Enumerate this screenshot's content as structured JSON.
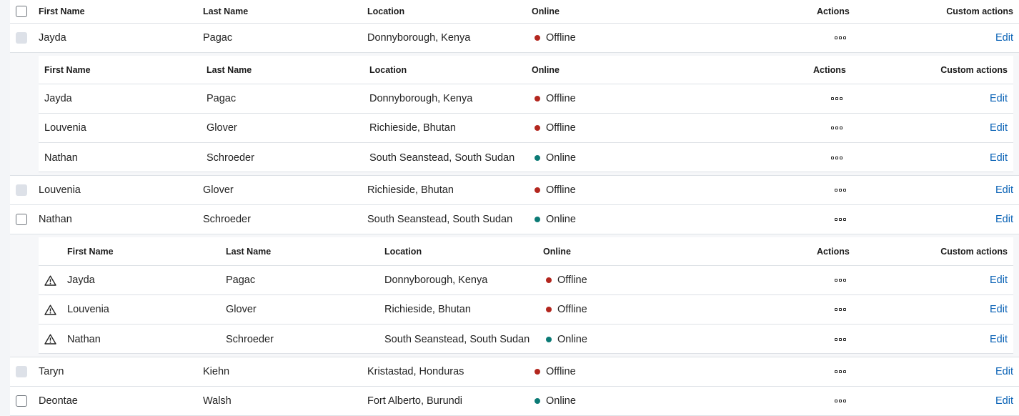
{
  "columns": {
    "first_name": "First Name",
    "last_name": "Last Name",
    "location": "Location",
    "online": "Online",
    "actions": "Actions",
    "custom_actions": "Custom actions"
  },
  "edit_label": "Edit",
  "status_colors": {
    "Offline": "#b3261e",
    "Online": "#0b7a75"
  },
  "rows": [
    {
      "first": "Jayda",
      "last": "Pagac",
      "location": "Donnyborough, Kenya",
      "status": "Offline",
      "checkbox": "disabled"
    },
    {
      "first": "Louvenia",
      "last": "Glover",
      "location": "Richieside, Bhutan",
      "status": "Offline",
      "checkbox": "disabled"
    },
    {
      "first": "Nathan",
      "last": "Schroeder",
      "location": "South Seanstead, South Sudan",
      "status": "Online",
      "checkbox": "enabled"
    },
    {
      "first": "Taryn",
      "last": "Kiehn",
      "location": "Kristastad, Honduras",
      "status": "Offline",
      "checkbox": "disabled"
    },
    {
      "first": "Deontae",
      "last": "Walsh",
      "location": "Fort Alberto, Burundi",
      "status": "Online",
      "checkbox": "enabled"
    }
  ],
  "nested_a": [
    {
      "first": "Jayda",
      "last": "Pagac",
      "location": "Donnyborough, Kenya",
      "status": "Offline"
    },
    {
      "first": "Louvenia",
      "last": "Glover",
      "location": "Richieside, Bhutan",
      "status": "Offline"
    },
    {
      "first": "Nathan",
      "last": "Schroeder",
      "location": "South Seanstead, South Sudan",
      "status": "Online"
    }
  ],
  "nested_b": [
    {
      "first": "Jayda",
      "last": "Pagac",
      "location": "Donnyborough, Kenya",
      "status": "Offline",
      "icon": "warning-icon"
    },
    {
      "first": "Louvenia",
      "last": "Glover",
      "location": "Richieside, Bhutan",
      "status": "Offline",
      "icon": "warning-icon"
    },
    {
      "first": "Nathan",
      "last": "Schroeder",
      "location": "South Seanstead, South Sudan",
      "status": "Online",
      "icon": "warning-icon"
    }
  ]
}
